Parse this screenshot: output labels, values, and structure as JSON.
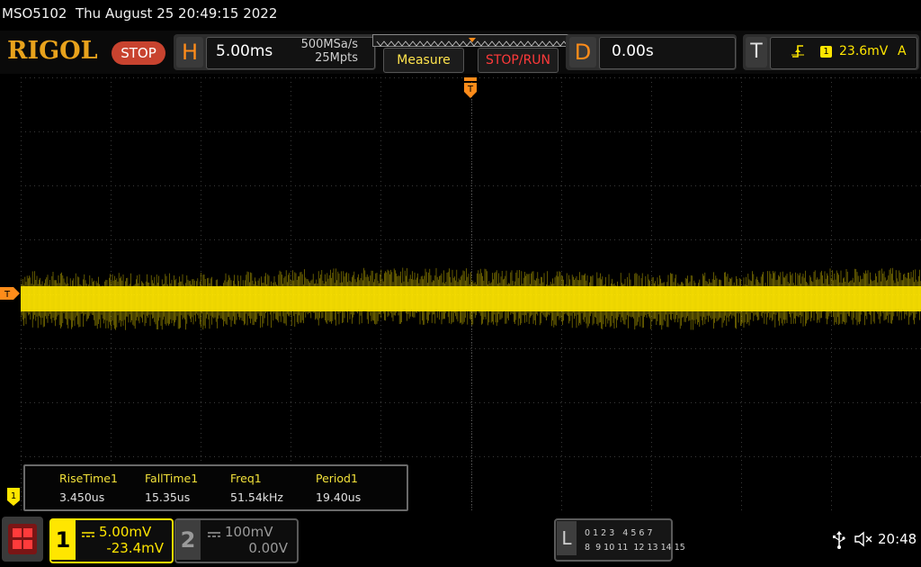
{
  "title_bar": {
    "model": "MSO5102",
    "datetime": "Thu August 25 20:49:15 2022"
  },
  "brand": {
    "logo": "RIGOL",
    "run_state": "STOP"
  },
  "horizontal": {
    "letter": "H",
    "timebase": "5.00ms",
    "sample_rate": "500MSa/s",
    "memory_depth": "25Mpts"
  },
  "buttons": {
    "measure": "Measure",
    "stop_run": "STOP/RUN"
  },
  "delay": {
    "letter": "D",
    "value": "0.00s"
  },
  "trigger": {
    "letter": "T",
    "source": "1",
    "level": "23.6mV",
    "mode": "A",
    "edge_icon": "rising-edge-icon"
  },
  "markers": {
    "trigger_position": "T",
    "trigger_level": "T",
    "channel1": "1"
  },
  "measurements": [
    {
      "name": "RiseTime1",
      "value": "3.450us"
    },
    {
      "name": "FallTime1",
      "value": "15.35us"
    },
    {
      "name": "Freq1",
      "value": "51.54kHz"
    },
    {
      "name": "Period1",
      "value": "19.40us"
    }
  ],
  "channels": [
    {
      "number": "1",
      "scale": "5.00mV",
      "offset": "-23.4mV",
      "color": "#ffe600",
      "coupling_icon": "dc-coupling-icon"
    },
    {
      "number": "2",
      "scale": "100mV",
      "offset": "0.00V",
      "color": "#9a9a9a",
      "coupling_icon": "dc-coupling-icon"
    }
  ],
  "logic_analyzer": {
    "letter": "L",
    "row1": "0 1 2 3   4 5 6 7",
    "row2": "8  9 10 11  12 13 14 15"
  },
  "status": {
    "clock": "20:48",
    "usb_icon": "usb-icon",
    "speaker_icon": "speaker-muted-icon"
  },
  "colors": {
    "ch1": "#ffe600",
    "accent_orange": "#ff8c1a",
    "stop_red": "#c8432f"
  }
}
